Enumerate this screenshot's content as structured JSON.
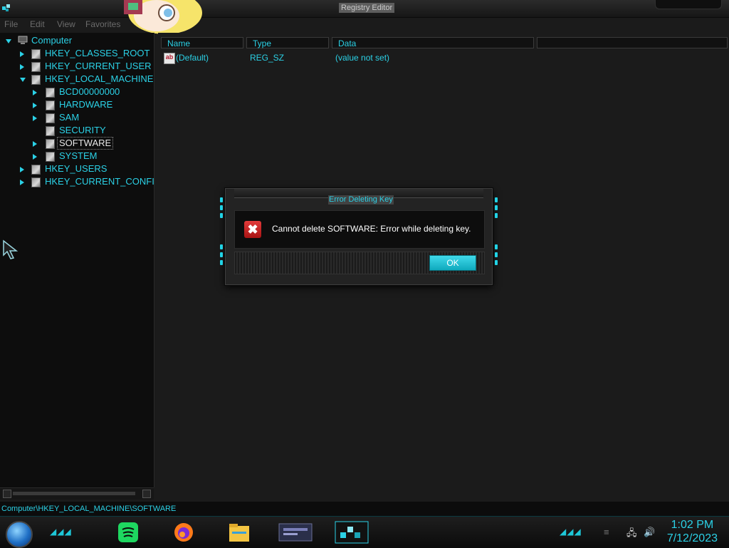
{
  "window": {
    "title": "Registry Editor"
  },
  "menu": [
    "File",
    "Edit",
    "View",
    "Favorites"
  ],
  "tree": {
    "root": "Computer",
    "items": [
      {
        "label": "HKEY_CLASSES_ROOT"
      },
      {
        "label": "HKEY_CURRENT_USER"
      },
      {
        "label": "HKEY_LOCAL_MACHINE"
      },
      {
        "label": "BCD00000000"
      },
      {
        "label": "HARDWARE"
      },
      {
        "label": "SAM"
      },
      {
        "label": "SECURITY"
      },
      {
        "label": "SOFTWARE"
      },
      {
        "label": "SYSTEM"
      },
      {
        "label": "HKEY_USERS"
      },
      {
        "label": "HKEY_CURRENT_CONFI"
      }
    ]
  },
  "columns": {
    "name": "Name",
    "type": "Type",
    "data": "Data"
  },
  "values": [
    {
      "name": "(Default)",
      "type": "REG_SZ",
      "data": "(value not set)"
    }
  ],
  "status": {
    "path": "Computer\\HKEY_LOCAL_MACHINE\\SOFTWARE"
  },
  "dialog": {
    "title": "Error Deleting Key",
    "message": "Cannot delete SOFTWARE:  Error while deleting key.",
    "ok_label": "OK"
  },
  "taskbar": {
    "time": "1:02 PM",
    "date": "7/12/2023"
  },
  "colors": {
    "accent": "#2bd1e6",
    "background": "#1b1b1b",
    "error": "#c62020"
  }
}
